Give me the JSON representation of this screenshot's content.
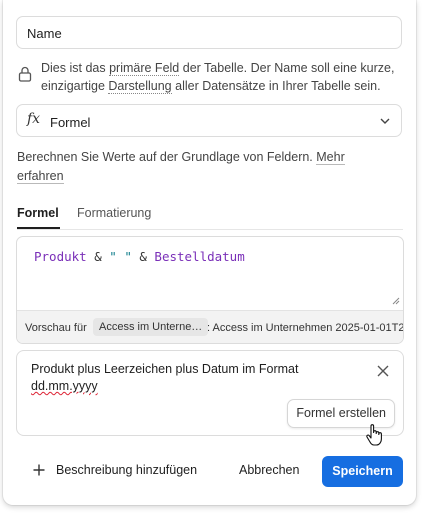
{
  "name_field": {
    "value": "Name"
  },
  "primary_info": {
    "before": "Dies ist das ",
    "underlined": "primäre Feld",
    "after": " der Tabelle. Der Name soll eine kurze, einzigartige ",
    "underlined2": "Darstellung",
    "after2": " aller Datensätze in Ihrer Tabelle sein."
  },
  "field_type": {
    "label": "Formel",
    "icon": "function-icon"
  },
  "description": {
    "text": "Berechnen Sie Werte auf der Grundlage von Feldern. ",
    "link": "Mehr erfahren"
  },
  "tabs": [
    {
      "label": "Formel",
      "active": true
    },
    {
      "label": "Formatierung",
      "active": false
    }
  ],
  "formula": {
    "field1": "Produkt",
    "op1": " & ",
    "str": "\" \"",
    "op2": " & ",
    "field2": "Bestelldatum"
  },
  "preview": {
    "label": "Vorschau für",
    "record": "Access im Unterne…",
    "value": ": Access im Unternehmen 2025-01-01T2"
  },
  "ai_prompt": {
    "text_before": "Produkt plus Leerzeichen plus Datum im Format ",
    "text_misspelled": "dd.mm.yyyy",
    "create_label": "Formel erstellen"
  },
  "footer": {
    "add_description": "Beschreibung hinzufügen",
    "cancel": "Abbrechen",
    "save": "Speichern"
  },
  "colors": {
    "accent": "#166ee1",
    "field_token": "#7a2fb8",
    "string_token": "#0d7c8a"
  }
}
